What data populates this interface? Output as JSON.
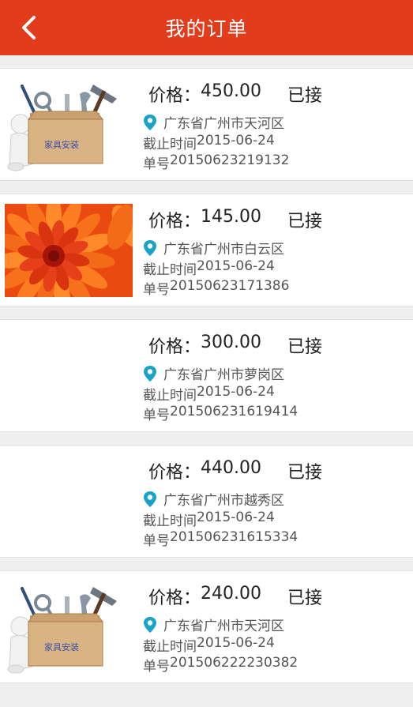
{
  "header": {
    "title": "我的订单"
  },
  "labels": {
    "price": "价格：",
    "deadline": "截止时间",
    "orderno": "单号"
  },
  "colors": {
    "header_bg": "#e23c1d",
    "pin": "#1aa3c8"
  },
  "orders": [
    {
      "image": "toolbox-furniture-install",
      "toolbox_text": "家具安装",
      "price": "450.00",
      "status": "已接",
      "address": "广东省广州市天河区",
      "deadline": "2015-06-24",
      "order_no": "20150623219132"
    },
    {
      "image": "orange-chrysanthemum-photo",
      "price": "145.00",
      "status": "已接",
      "address": "广东省广州市白云区",
      "deadline": "2015-06-24",
      "order_no": "20150623171386"
    },
    {
      "image": "",
      "price": "300.00",
      "status": "已接",
      "address": "广东省广州市萝岗区",
      "deadline": "2015-06-24",
      "order_no": "201506231619414"
    },
    {
      "image": "",
      "price": "440.00",
      "status": "已接",
      "address": "广东省广州市越秀区",
      "deadline": "2015-06-24",
      "order_no": "201506231615334"
    },
    {
      "image": "toolbox-furniture-install",
      "toolbox_text": "家具安装",
      "price": "240.00",
      "status": "已接",
      "address": "广东省广州市天河区",
      "deadline": "2015-06-24",
      "order_no": "201506222230382"
    }
  ]
}
